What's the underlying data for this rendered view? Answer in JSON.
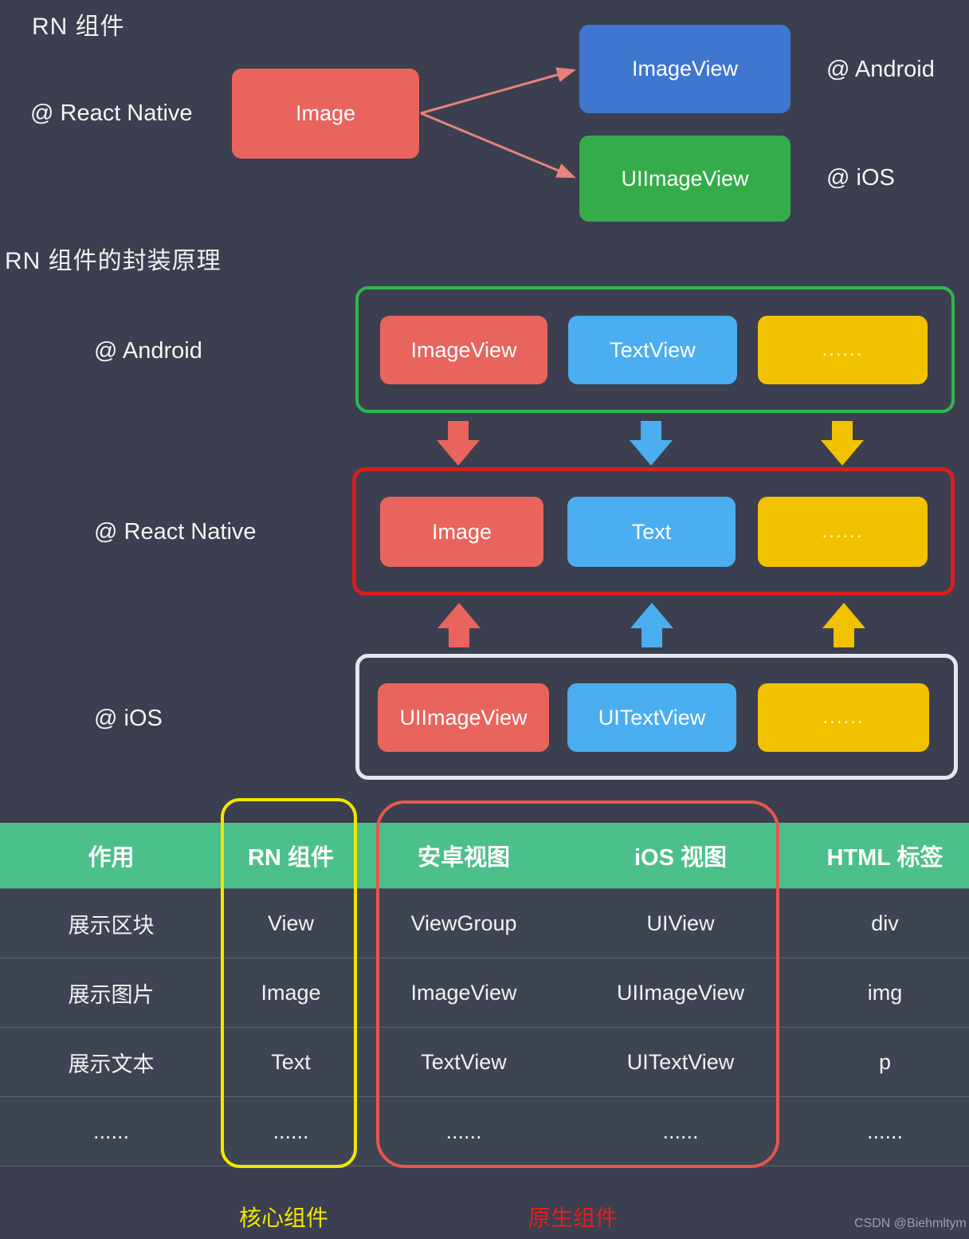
{
  "palette": {
    "background": "#3b3f4f",
    "red": "#e8645c",
    "blue": "#4aaef0",
    "dark_blue": "#3e76d0",
    "green": "#35ac4a",
    "yellow": "#f2c200",
    "table_header_green": "#4cc08a",
    "outline_green": "#2db84d",
    "outline_red": "#d61f1f",
    "outline_white": "#e4e6ea",
    "outline_yellow": "#f2e600",
    "caption_red": "#e02020"
  },
  "section_one": {
    "title": "RN 组件",
    "source_label": "@ React Native",
    "source_box": "Image",
    "targets": [
      {
        "box": "ImageView",
        "platform": "@ Android"
      },
      {
        "box": "UIImageView",
        "platform": "@ iOS"
      }
    ]
  },
  "section_two": {
    "title": "RN 组件的封装原理",
    "rows": [
      {
        "label": "@ Android",
        "outline": "green",
        "chips": [
          {
            "text": "ImageView",
            "color": "red"
          },
          {
            "text": "TextView",
            "color": "blue"
          },
          {
            "text": "......",
            "color": "yellow"
          }
        ]
      },
      {
        "label": "@ React Native",
        "outline": "red",
        "chips": [
          {
            "text": "Image",
            "color": "red"
          },
          {
            "text": "Text",
            "color": "blue"
          },
          {
            "text": "......",
            "color": "yellow"
          }
        ]
      },
      {
        "label": "@ iOS",
        "outline": "white",
        "chips": [
          {
            "text": "UIImageView",
            "color": "red"
          },
          {
            "text": "UITextView",
            "color": "blue"
          },
          {
            "text": "......",
            "color": "yellow"
          }
        ]
      }
    ]
  },
  "table": {
    "headers": [
      "作用",
      "RN 组件",
      "安卓视图",
      "iOS 视图",
      "HTML 标签"
    ],
    "rows": [
      [
        "展示区块",
        "View",
        "ViewGroup",
        "UIView",
        "div"
      ],
      [
        "展示图片",
        "Image",
        "ImageView",
        "UIImageView",
        "img"
      ],
      [
        "展示文本",
        "Text",
        "TextView",
        "UITextView",
        "p"
      ],
      [
        "......",
        "......",
        "......",
        "......",
        "......"
      ]
    ]
  },
  "captions": {
    "core": "核心组件",
    "native": "原生组件"
  },
  "watermark": "CSDN @Biehmltym"
}
